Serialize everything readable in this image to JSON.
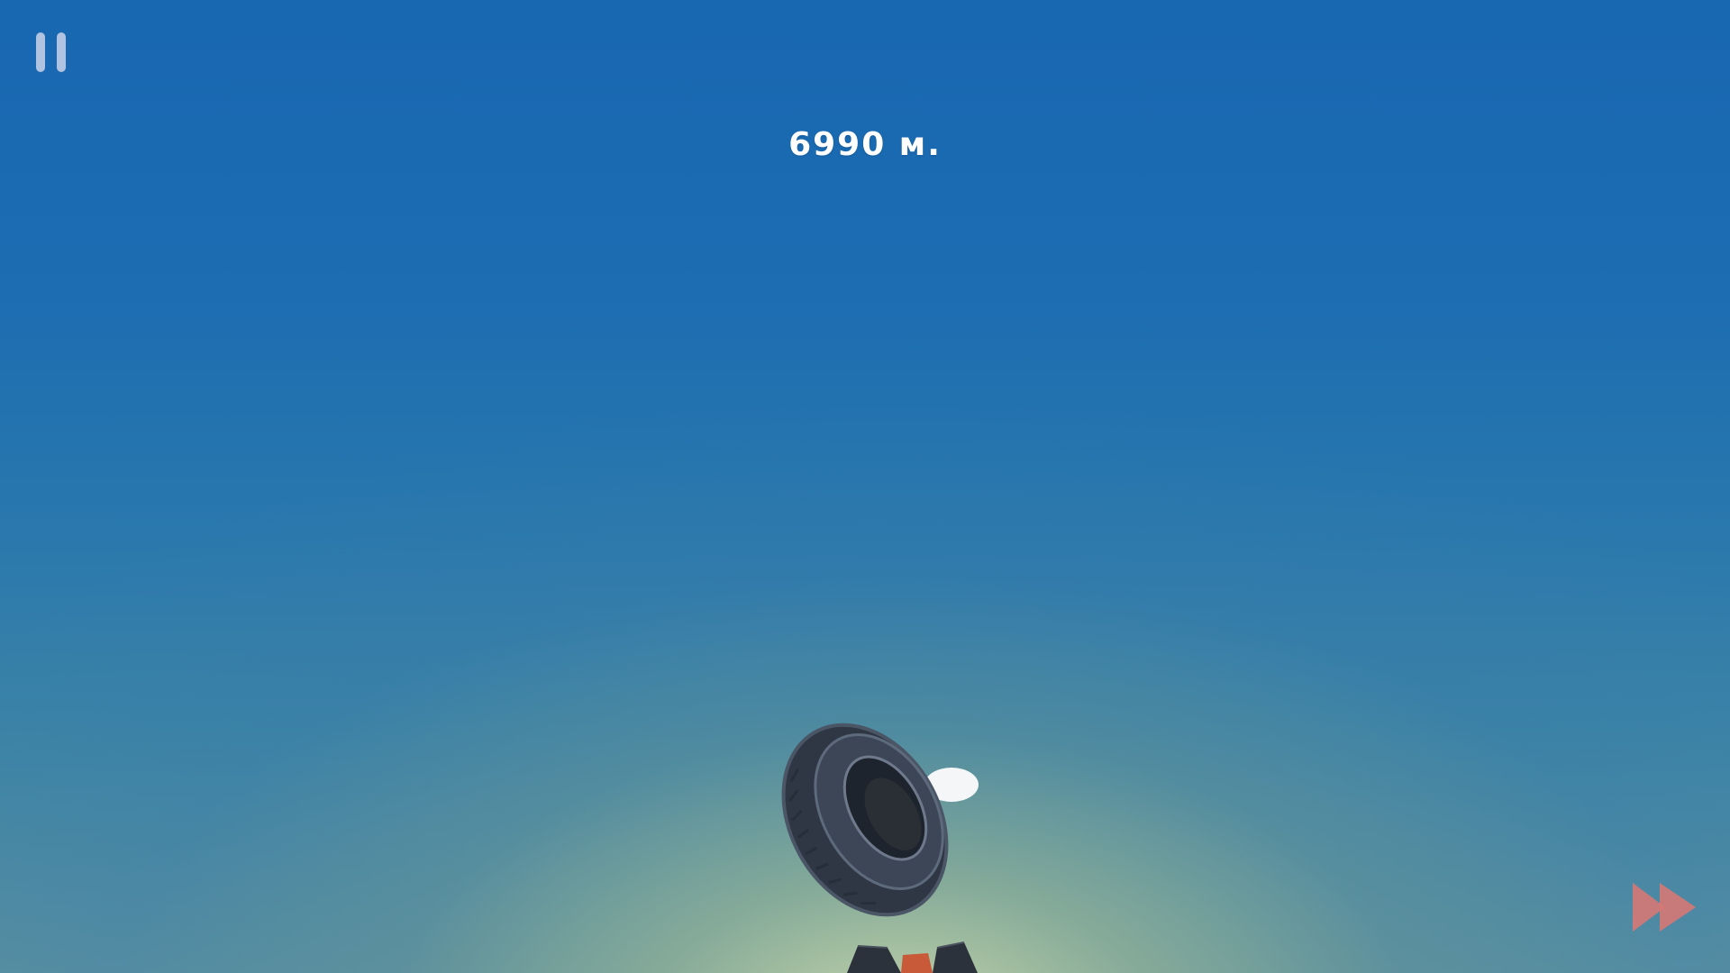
{
  "hud": {
    "distance": "6990 м."
  },
  "icons": {
    "pause": "pause-icon",
    "fast_forward": "fast-forward-icon"
  },
  "colors": {
    "sky_top": "#1867b1",
    "sky_horizon_glow": "#c8d7aa",
    "pause_icon": "#d2d7eb",
    "fast_forward_icon": "#d67876",
    "tire": "#333b48",
    "launcher_accent": "#c85a3a"
  }
}
